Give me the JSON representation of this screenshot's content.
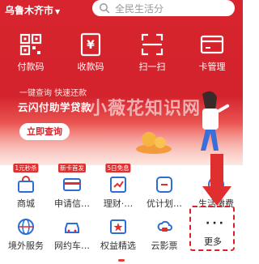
{
  "top_bar": {
    "city": "乌鲁木齐市",
    "search_placeholder": "全民生活分"
  },
  "quick_actions": [
    {
      "label": "付款码",
      "icon": "payment-code-icon"
    },
    {
      "label": "收款码",
      "icon": "receive-code-icon"
    },
    {
      "label": "扫一扫",
      "icon": "scan-icon"
    },
    {
      "label": "卡管理",
      "icon": "card-management-icon"
    }
  ],
  "banner": {
    "subtitle": "一键查询 快速还款",
    "title": "云闪付助学贷款",
    "title_cont": "服务",
    "button": "立即查询",
    "watermark": "小薇花知识网"
  },
  "services_row1": [
    {
      "label": "商城",
      "tag": "1元秒杀",
      "icon": "mall-icon"
    },
    {
      "label": "申请信…",
      "tag": "新卡首发",
      "icon": "credit-card-apply-icon"
    },
    {
      "label": "理财·…",
      "tag": "5日免息",
      "icon": "wealth-icon"
    },
    {
      "label": "优计划…",
      "tag": "",
      "icon": "plan-icon"
    },
    {
      "label": "生活缴费",
      "tag": "",
      "icon": "bill-pay-icon"
    }
  ],
  "services_row2": [
    {
      "label": "境外服务",
      "icon": "overseas-icon"
    },
    {
      "label": "网约车…",
      "icon": "ride-hailing-icon"
    },
    {
      "label": "权益精选",
      "icon": "benefits-icon"
    },
    {
      "label": "云影票",
      "icon": "movie-ticket-icon"
    },
    {
      "label": "更多",
      "icon": "more-icon"
    }
  ],
  "colors": {
    "brand_red": "#d3232c",
    "accent": "#e02f2f"
  }
}
